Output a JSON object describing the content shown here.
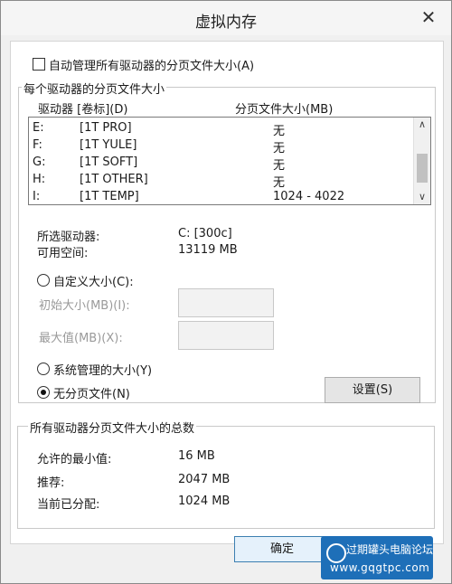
{
  "window": {
    "title": "虚拟内存"
  },
  "auto_manage": {
    "label": "自动管理所有驱动器的分页文件大小(A)",
    "checked": false
  },
  "per_drive": {
    "legend": "每个驱动器的分页文件大小",
    "col_drive": "驱动器 [卷标](D)",
    "col_size": "分页文件大小(MB)",
    "rows": [
      {
        "drive": "E:",
        "label": "[1T PRO]",
        "size": "无"
      },
      {
        "drive": "F:",
        "label": "[1T YULE]",
        "size": "无"
      },
      {
        "drive": "G:",
        "label": "[1T SOFT]",
        "size": "无"
      },
      {
        "drive": "H:",
        "label": "[1T OTHER]",
        "size": "无"
      },
      {
        "drive": "I:",
        "label": "[1T TEMP]",
        "size": "1024 - 4022"
      }
    ],
    "selected_drive_label": "所选驱动器:",
    "selected_drive_value": "C:  [300c]",
    "free_space_label": "可用空间:",
    "free_space_value": "13119 MB",
    "custom_size": {
      "label": "自定义大小(C):",
      "selected": false
    },
    "initial_size_label": "初始大小(MB)(I):",
    "max_size_label": "最大值(MB)(X):",
    "system_managed": {
      "label": "系统管理的大小(Y)",
      "selected": false
    },
    "no_paging": {
      "label": "无分页文件(N)",
      "selected": true
    },
    "set_button": "设置(S)"
  },
  "totals": {
    "legend": "所有驱动器分页文件大小的总数",
    "min_label": "允许的最小值:",
    "min_value": "16 MB",
    "recommended_label": "推荐:",
    "recommended_value": "2047 MB",
    "current_label": "当前已分配:",
    "current_value": "1024 MB"
  },
  "ok_button": "确定",
  "watermark": {
    "text": "过期罐头电脑论坛",
    "url": "www.gqgtpc.com"
  }
}
